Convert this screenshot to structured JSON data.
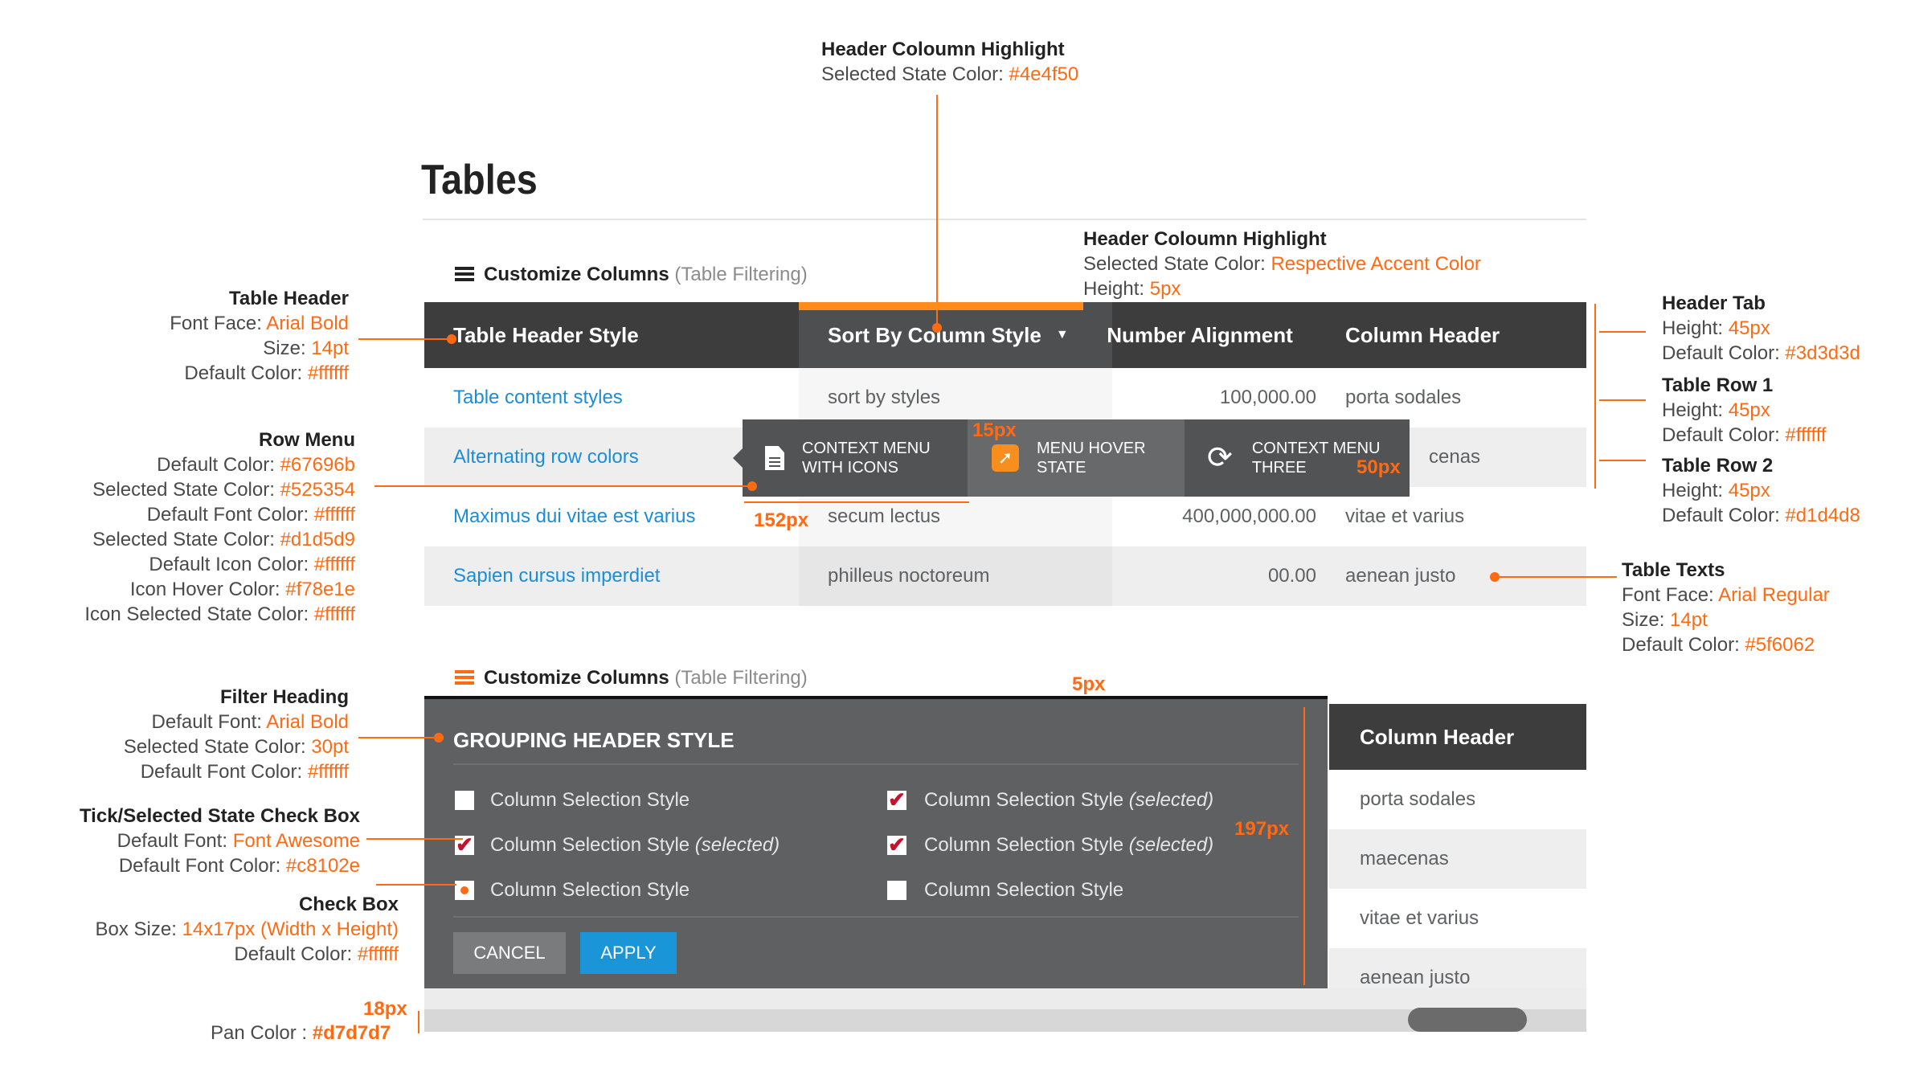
{
  "title": "Tables",
  "customize": {
    "label": "Customize Columns",
    "sub": "(Table Filtering)"
  },
  "table": {
    "headers": [
      "Table Header Style",
      "Sort By Column Style",
      "Number Alignment",
      "Column Header"
    ],
    "rows": [
      [
        "Table content styles",
        "sort by styles",
        "100,000.00",
        "porta sodales"
      ],
      [
        "Alternating row colors",
        "",
        "",
        "cenas"
      ],
      [
        "Maximus dui vitae est varius",
        "secum lectus",
        "400,000,000.00",
        "vitae et varius"
      ],
      [
        "Sapien cursus imperdiet",
        "philleus noctoreum",
        "00.00",
        "aenean justo"
      ]
    ]
  },
  "context_menu": [
    {
      "label1": "CONTEXT MENU",
      "label2": "WITH ICONS",
      "icon": "document-icon"
    },
    {
      "label1": "MENU HOVER",
      "label2": "STATE",
      "icon": "share-icon"
    },
    {
      "label1": "CONTEXT MENU",
      "label2": "THREE",
      "icon": "refresh-icon"
    }
  ],
  "panel": {
    "heading": "GROUPING HEADER STYLE",
    "options": [
      {
        "label": "Column Selection Style",
        "emph": "",
        "checked": false
      },
      {
        "label": "Column Selection Style",
        "emph": "(selected)",
        "checked": true
      },
      {
        "label": "Column Selection Style",
        "emph": "(selected)",
        "checked": true
      },
      {
        "label": "Column Selection Style",
        "emph": "(selected)",
        "checked": true
      },
      {
        "label": "Column Selection Style",
        "emph": "",
        "checked": false
      },
      {
        "label": "Column Selection Style",
        "emph": "",
        "checked": false
      }
    ],
    "cancel": "CANCEL",
    "apply": "APPLY"
  },
  "right_table": {
    "header": "Column Header",
    "rows": [
      "porta sodales",
      "maecenas",
      "vitae et varius",
      "aenean justo"
    ]
  },
  "annotations": {
    "top": {
      "title": "Header Coloumn Highlight",
      "label": "Selected State Color: ",
      "value": "#4e4f50"
    },
    "highlight": {
      "title": "Header Coloumn Highlight",
      "l1": "Selected State Color: ",
      "v1": "Respective Accent Color",
      "l2": "Height: ",
      "v2": "5px"
    },
    "table_header": {
      "title": "Table Header",
      "l1": "Font Face: ",
      "v1": "Arial Bold",
      "l2": "Size: ",
      "v2": "14pt",
      "l3": "Default Color: ",
      "v3": "#ffffff"
    },
    "row_menu": {
      "title": "Row Menu",
      "lines": [
        {
          "l": "Default Color: ",
          "v": "#67696b"
        },
        {
          "l": "Selected State Color: ",
          "v": "#525354"
        },
        {
          "l": "Default Font Color: ",
          "v": "#ffffff"
        },
        {
          "l": "Selected State Color: ",
          "v": "#d1d5d9"
        },
        {
          "l": "Default Icon Color: ",
          "v": "#ffffff"
        },
        {
          "l": "Icon Hover Color: ",
          "v": "#f78e1e"
        },
        {
          "l": "Icon Selected State Color: ",
          "v": "#ffffff"
        }
      ]
    },
    "filter_heading": {
      "title": "Filter Heading",
      "l1": "Default Font: ",
      "v1": "Arial Bold",
      "l2": "Selected State Color: ",
      "v2": "30pt",
      "l3": "Default Font Color: ",
      "v3": "#ffffff"
    },
    "tick_box": {
      "title": "Tick/Selected State Check Box",
      "l1": "Default Font: ",
      "v1": "Font Awesome",
      "l2": "Default Font Color: ",
      "v2": "#c8102e"
    },
    "check_box": {
      "title": "Check Box",
      "l1": "Box Size: ",
      "v1": "14x17px (Width x Height)",
      "l2": "Default Color: ",
      "v2": "#ffffff"
    },
    "pan": {
      "size": "18px",
      "label": "Pan Color : ",
      "value": "#d7d7d7"
    },
    "header_tab": {
      "title": "Header Tab",
      "l1": "Height: ",
      "v1": "45px",
      "l2": "Default Color: ",
      "v2": "#3d3d3d"
    },
    "row1": {
      "title": "Table Row 1",
      "l1": "Height: ",
      "v1": "45px",
      "l2": "Default Color: ",
      "v2": "#ffffff"
    },
    "row2": {
      "title": "Table Row 2",
      "l1": "Height: ",
      "v1": "45px",
      "l2": "Default Color: ",
      "v2": "#d1d4d8"
    },
    "texts": {
      "title": "Table Texts",
      "l1": "Font Face: ",
      "v1": "Arial Regular",
      "l2": "Size: ",
      "v2": "14pt",
      "l3": "Default Color: ",
      "v3": "#5f6062"
    },
    "dims": {
      "d15": "15px",
      "d50": "50px",
      "d152": "152px",
      "d5": "5px",
      "d197": "197px"
    }
  },
  "colors": {
    "accent": "#ff6a13",
    "header": "#3d3d3d",
    "link": "#1a8ed8",
    "panel": "#5f6062",
    "menu": "#525354",
    "check": "#c8102e",
    "apply": "#1a95d8"
  }
}
